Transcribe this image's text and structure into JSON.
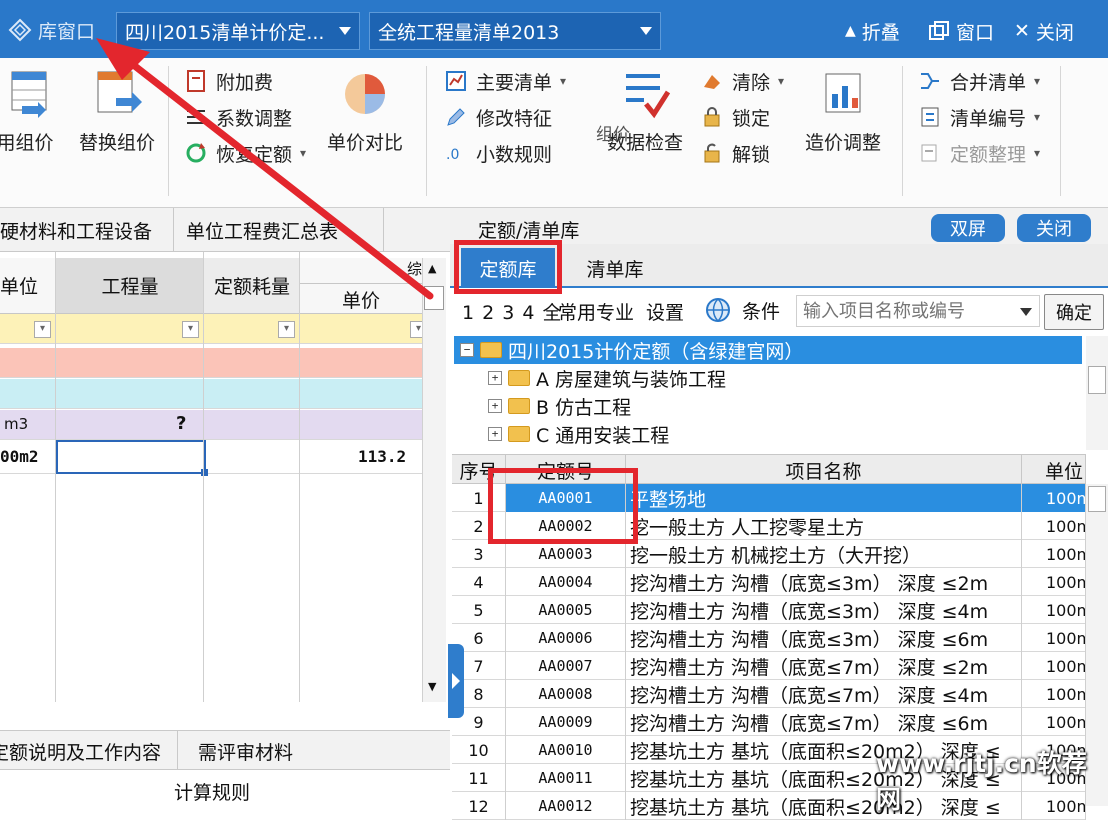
{
  "titlebar": {
    "lib_window": "库窗口",
    "quota_combo": "四川2015清单计价定...",
    "list_combo": "全统工程量清单2013",
    "collapse": "折叠",
    "window": "窗口",
    "close": "关闭",
    "colors": {
      "bar": "#2a78c9",
      "accent": "#2f7dcc",
      "annotation": "#e3262d"
    }
  },
  "ribbon": {
    "use_group": "用组价",
    "replace_group": "替换组价",
    "additional_fee": "附加费",
    "coefficient": "系数调整",
    "restore_quota": "恢复定额",
    "unit_price_compare": "单价对比",
    "main_list": "主要清单",
    "modify_feature": "修改特征",
    "decimal_rule": "小数规则",
    "data_check": "数据检查",
    "clear": "清除",
    "lock": "锁定",
    "unlock": "解锁",
    "cost_adjust": "造价调整",
    "merge_list": "合并清单",
    "list_number": "清单编号",
    "quota_organize": "定额整理",
    "group_label": "组价"
  },
  "left": {
    "tab_materials": "硬材料和工程设备",
    "tab_summary": "单位工程费汇总表",
    "col_unit": "单位",
    "col_quantity": "工程量",
    "col_consumption": "定额耗量",
    "col_price_partial": "综",
    "col_unit_price": "单价",
    "row4_unit": "m3",
    "row4_qty": "?",
    "row5_unit": "00m2",
    "row5_price": "113.2",
    "bottom_tab_desc": "定额说明及工作内容",
    "bottom_tab_review": "需评审材料",
    "calc_rules": "计算规则"
  },
  "right": {
    "title": "定额/清单库",
    "dual_screen": "双屏",
    "close": "关闭",
    "tab_quota": "定额库",
    "tab_list": "清单库",
    "levels": "1 2 3 4 全",
    "common_specialty": "常用专业",
    "settings": "设置",
    "condition": "条件",
    "search_placeholder": "输入项目名称或编号",
    "confirm": "确定",
    "tree": [
      {
        "label": "四川2015计价定额（含绿建官网）",
        "expander": "−"
      },
      {
        "label": "A 房屋建筑与装饰工程",
        "expander": "+"
      },
      {
        "label": "B 仿古工程",
        "expander": "+"
      },
      {
        "label": "C 通用安装工程",
        "expander": "+"
      }
    ],
    "grid_headers": {
      "seq": "序号",
      "code": "定额号",
      "name": "项目名称",
      "unit": "单位"
    },
    "rows": [
      {
        "seq": "1",
        "code": "AA0001",
        "name": "平整场地",
        "unit": "100m"
      },
      {
        "seq": "2",
        "code": "AA0002",
        "name": "挖一般土方 人工挖零星土方",
        "unit": "100m"
      },
      {
        "seq": "3",
        "code": "AA0003",
        "name": "挖一般土方 机械挖土方（大开挖）",
        "unit": "100m"
      },
      {
        "seq": "4",
        "code": "AA0004",
        "name": "挖沟槽土方 沟槽（底宽≤3m） 深度 ≤2m",
        "unit": "100m"
      },
      {
        "seq": "5",
        "code": "AA0005",
        "name": "挖沟槽土方 沟槽（底宽≤3m） 深度 ≤4m",
        "unit": "100m"
      },
      {
        "seq": "6",
        "code": "AA0006",
        "name": "挖沟槽土方 沟槽（底宽≤3m） 深度 ≤6m",
        "unit": "100m"
      },
      {
        "seq": "7",
        "code": "AA0007",
        "name": "挖沟槽土方 沟槽（底宽≤7m） 深度 ≤2m",
        "unit": "100m"
      },
      {
        "seq": "8",
        "code": "AA0008",
        "name": "挖沟槽土方 沟槽（底宽≤7m） 深度 ≤4m",
        "unit": "100m"
      },
      {
        "seq": "9",
        "code": "AA0009",
        "name": "挖沟槽土方 沟槽（底宽≤7m） 深度 ≤6m",
        "unit": "100m"
      },
      {
        "seq": "10",
        "code": "AA0010",
        "name": "挖基坑土方 基坑（底面积≤20m2） 深度 ≤",
        "unit": "100m"
      },
      {
        "seq": "11",
        "code": "AA0011",
        "name": "挖基坑土方 基坑（底面积≤20m2） 深度 ≤",
        "unit": "100m"
      },
      {
        "seq": "12",
        "code": "AA0012",
        "name": "挖基坑土方 基坑（底面积≤20m2） 深度 ≤",
        "unit": "100m"
      }
    ]
  },
  "watermark": "www.rjtj.cn软荐网"
}
